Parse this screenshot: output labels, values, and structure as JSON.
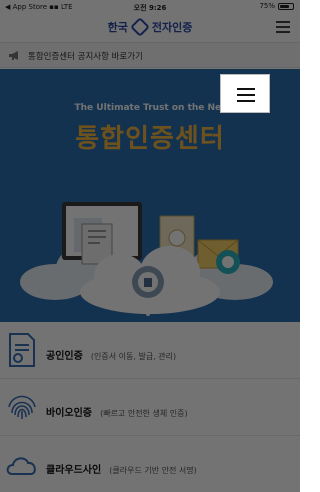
{
  "status_bar": {
    "carrier": "◀ App Store ▪▪ LTE",
    "time": "오전 9:26",
    "battery": "75%",
    "battery_level": 0.75
  },
  "header": {
    "brand_prefix": "한국",
    "brand_name": "전자인증",
    "menu_icon": "hamburger-icon"
  },
  "notice": {
    "icon": "megaphone-icon",
    "text": "통합인증센터 공지사항 바로가기"
  },
  "hero": {
    "subtitle": "The Ultimate Trust on the Net",
    "title": "통합인증센터",
    "slide_count": 1,
    "active_slide": 1
  },
  "overlay_menu": {
    "icon": "hamburger-icon"
  },
  "services": [
    {
      "name": "공인인증",
      "desc": "(인증서 이동, 발급, 관리)",
      "icon": "certificate-icon"
    },
    {
      "name": "바이오인증",
      "desc": "(빠르고 안전한 생체 인증)",
      "icon": "fingerprint-icon"
    },
    {
      "name": "클라우드사인",
      "desc": "(클라우드 기반 안전 서명)",
      "icon": "cloud-icon"
    }
  ],
  "colors": {
    "hero_bg": "#2c6fb1",
    "hero_title": "#f3b640",
    "brand": "#2a4ba8",
    "dim_overlay": "rgba(0,0,0,0.55)"
  }
}
